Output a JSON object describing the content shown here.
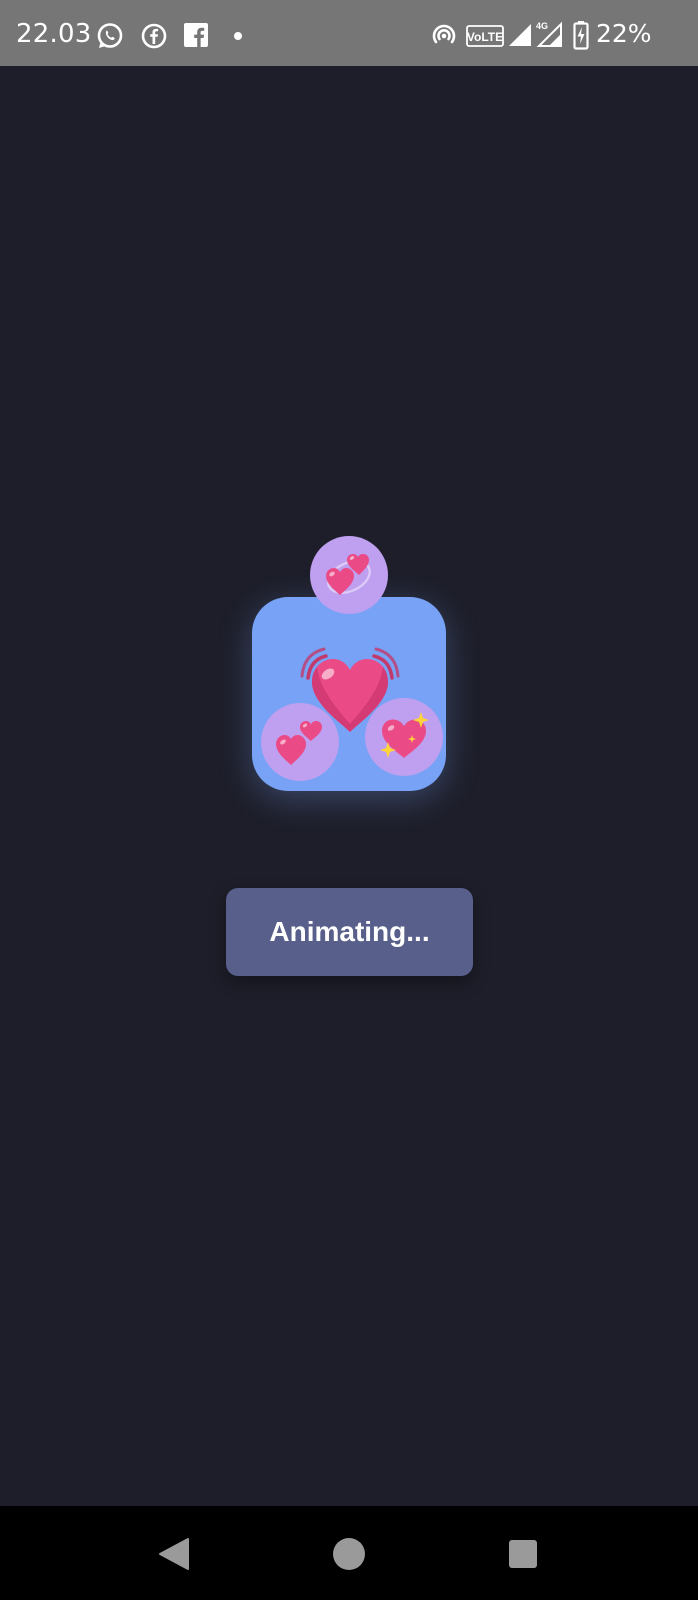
{
  "status_bar": {
    "time": "22.03",
    "notification_icons": [
      "whatsapp-icon",
      "facebook-messenger-icon",
      "facebook-icon",
      "more-notifications-dot-icon"
    ],
    "system_icons": [
      "hotspot-icon",
      "volte-icon",
      "signal-icon",
      "signal-4g-icon",
      "battery-charging-icon"
    ],
    "volte_label": "VoLTE",
    "network_label": "4G",
    "battery_percent": "22%"
  },
  "main": {
    "logo": {
      "card_color": "#77a2f5",
      "bubble_color": "#bf9ff0",
      "center_icon": "beating-heart-icon",
      "bubble_icons": [
        "revolving-hearts-icon",
        "two-hearts-icon",
        "sparkling-heart-icon"
      ]
    },
    "button": {
      "label": "Animating...",
      "color": "#575f8a"
    }
  },
  "nav_bar": {
    "buttons": [
      "back-icon",
      "home-icon",
      "recents-icon"
    ]
  },
  "colors": {
    "background": "#1d1e29",
    "status_bar": "#767676",
    "heart": "#ea4b86"
  }
}
